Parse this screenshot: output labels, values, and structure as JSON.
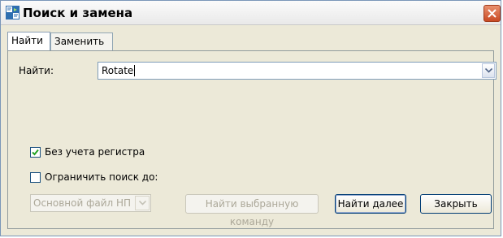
{
  "window": {
    "title": "Поиск и замена"
  },
  "tabs": [
    {
      "label": "Найти",
      "active": true
    },
    {
      "label": "Заменить",
      "active": false
    }
  ],
  "find": {
    "label": "Найти:",
    "value": "Rotate"
  },
  "options": {
    "case_insensitive": {
      "label": "Без учета регистра",
      "checked": true
    },
    "limit_search": {
      "label": "Ограничить поиск до:",
      "checked": false
    }
  },
  "scope": {
    "value": "Основной файл НП",
    "enabled": false
  },
  "buttons": {
    "find_selected": "Найти выбранную команду",
    "find_next": "Найти далее",
    "close": "Закрыть"
  },
  "icons": {
    "app": "search-replace-app-icon",
    "close": "close-icon",
    "dropdown": "chevron-down-icon",
    "check": "checkmark-icon"
  },
  "colors": {
    "close_button": "#c94a24",
    "checkbox_border": "#1c5180",
    "accent": "#0a246a"
  }
}
